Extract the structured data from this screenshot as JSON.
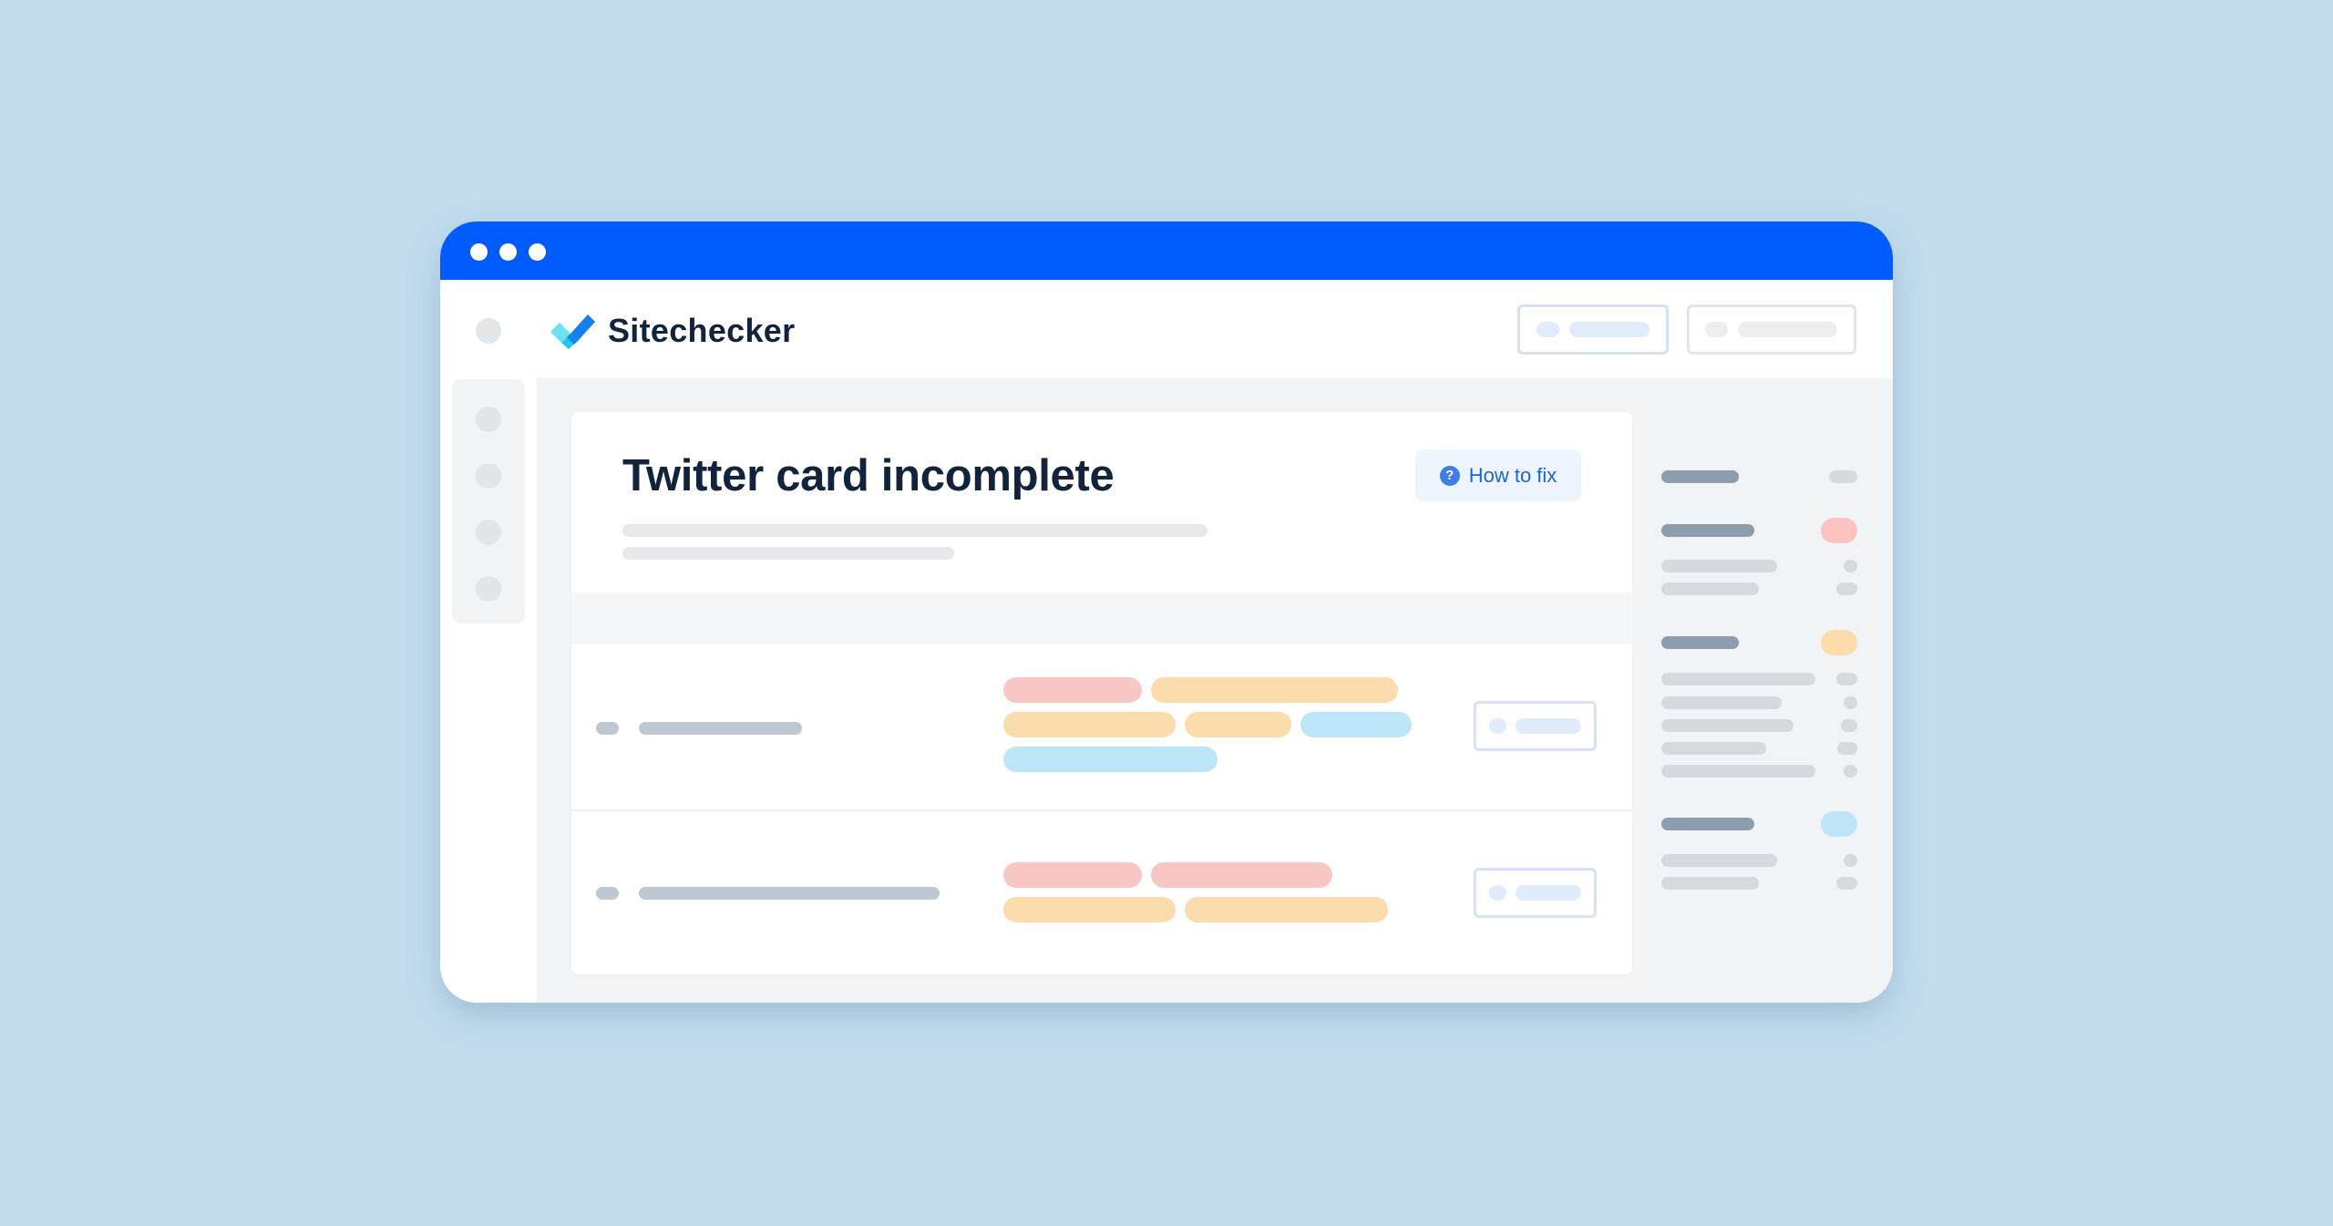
{
  "window": {
    "title_dots": [
      "close",
      "minimize",
      "maximize"
    ],
    "colors": {
      "titlebar": "#005cff",
      "background": "#c3ddef",
      "title_text": "#14233c",
      "link": "#1d64d6",
      "tag_red": "#f8c6c3",
      "tag_orange": "#fbdcad",
      "tag_blue": "#bde6f9",
      "placeholder_dark": "#8e9dad",
      "placeholder_mid": "#bfc8d1",
      "placeholder_light": "#d6dadf"
    }
  },
  "header": {
    "logo_icon": "checkmark-logo-icon",
    "brand": "Sitechecker",
    "buttons": [
      {
        "name": "header-primary-button",
        "style": "blue-outline"
      },
      {
        "name": "header-secondary-button",
        "style": "gray-outline"
      }
    ]
  },
  "sidebar": {
    "items": [
      "nav-item-1",
      "nav-item-2",
      "nav-item-3",
      "nav-item-4"
    ]
  },
  "issue": {
    "title": "Twitter card incomplete",
    "how_to_fix": {
      "icon": "question-circle-icon",
      "icon_glyph": "?",
      "label": "How to fix"
    }
  },
  "table": {
    "rows": [
      {
        "tags": [
          [
            "red",
            "orange"
          ],
          [
            "orange",
            "orange",
            "blue"
          ],
          [
            "blue"
          ]
        ]
      },
      {
        "tags": [
          [
            "red",
            "red"
          ],
          [
            "orange",
            "orange"
          ]
        ]
      }
    ]
  },
  "right_panel": {
    "groups": [
      {
        "status": "neutral",
        "sub_items": 0
      },
      {
        "status": "red",
        "sub_items": 2
      },
      {
        "status": "orange",
        "sub_items": 5
      },
      {
        "status": "blue",
        "sub_items": 2
      }
    ]
  }
}
